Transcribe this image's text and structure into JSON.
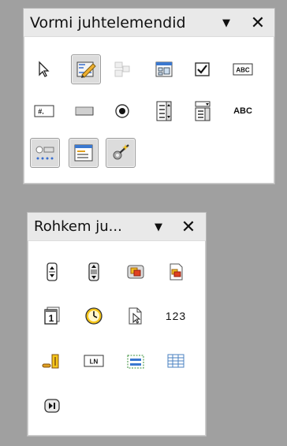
{
  "form_controls": {
    "title": "Vormi juhtelemendid",
    "menu_glyph": "▼",
    "close_glyph": "✕",
    "tools": [
      {
        "icon": "select-arrow-icon",
        "pressed": false
      },
      {
        "icon": "design-mode-icon",
        "pressed": true
      },
      {
        "icon": "control-properties-icon",
        "pressed": false,
        "disabled": true
      },
      {
        "icon": "form-properties-icon",
        "pressed": false
      },
      {
        "icon": "check-box-icon",
        "pressed": false
      },
      {
        "icon": "text-box-icon",
        "pressed": false,
        "label": "ABC"
      },
      {
        "icon": "formatted-field-icon",
        "pressed": false,
        "label": "#."
      },
      {
        "icon": "push-button-icon",
        "pressed": false
      },
      {
        "icon": "option-button-icon",
        "pressed": false
      },
      {
        "icon": "list-box-icon",
        "pressed": false
      },
      {
        "icon": "combo-box-icon",
        "pressed": false
      },
      {
        "icon": "label-field-icon",
        "pressed": false,
        "label": "ABC"
      },
      {
        "icon": "more-controls-icon",
        "pressed": true
      },
      {
        "icon": "form-design-icon",
        "pressed": true
      },
      {
        "icon": "wizards-icon",
        "pressed": true
      }
    ]
  },
  "more_controls": {
    "title": "Rohkem ju...",
    "menu_glyph": "▼",
    "close_glyph": "✕",
    "tools": [
      {
        "icon": "spin-button-icon"
      },
      {
        "icon": "scrollbar-icon"
      },
      {
        "icon": "image-button-icon"
      },
      {
        "icon": "image-control-icon"
      },
      {
        "icon": "date-field-icon",
        "label": "1"
      },
      {
        "icon": "time-field-icon"
      },
      {
        "icon": "file-selection-icon"
      },
      {
        "icon": "numerical-field-icon",
        "label": "123"
      },
      {
        "icon": "currency-field-icon"
      },
      {
        "icon": "pattern-field-icon",
        "label": "LN"
      },
      {
        "icon": "group-box-icon"
      },
      {
        "icon": "table-control-icon"
      },
      {
        "icon": "navigation-bar-icon"
      }
    ]
  }
}
